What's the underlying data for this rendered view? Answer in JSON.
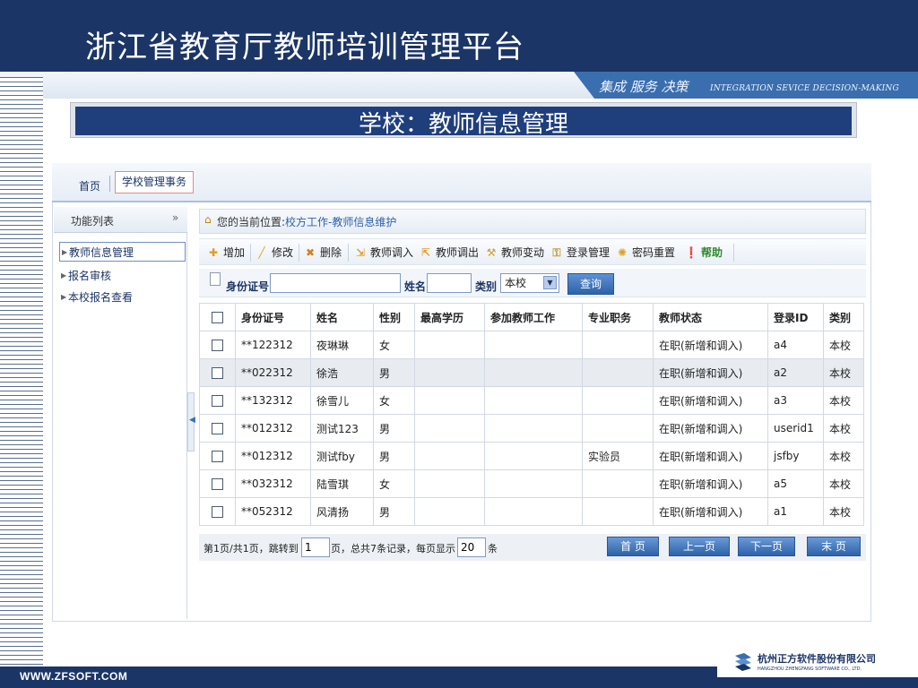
{
  "header": {
    "title": "浙江省教育厅教师培训管理平台",
    "slogan_cn": "集成 服务 决策",
    "slogan_en": "INTEGRATION SEVICE DECISION-MAKING"
  },
  "banner": {
    "title": "学校：教师信息管理"
  },
  "nav": {
    "home": "首页",
    "tab_active": "学校管理事务"
  },
  "sidebar": {
    "header": "功能列表",
    "collapse_icon": "chevron-double-down-icon",
    "items": [
      {
        "label": "教师信息管理",
        "active": true
      },
      {
        "label": "报名审核",
        "active": false
      },
      {
        "label": "本校报名查看",
        "active": false
      }
    ]
  },
  "breadcrumb": {
    "prefix": "您的当前位置:",
    "path": "校方工作-教师信息维护"
  },
  "toolbar": {
    "buttons": [
      {
        "label": "增加",
        "icon": "plus-icon",
        "color": "#e69a1c"
      },
      {
        "label": "修改",
        "icon": "pencil-icon",
        "color": "#d8a62a"
      },
      {
        "label": "删除",
        "icon": "delete-icon",
        "color": "#d97e1e"
      },
      {
        "label": "教师调入",
        "icon": "transfer-in-icon",
        "color": "#e49b2c"
      },
      {
        "label": "教师调出",
        "icon": "transfer-out-icon",
        "color": "#e49b2c"
      },
      {
        "label": "教师变动",
        "icon": "wrench-icon",
        "color": "#d69b2a"
      },
      {
        "label": "登录管理",
        "icon": "user-key-icon",
        "color": "#c99a3a"
      },
      {
        "label": "密码重置",
        "icon": "gear-icon",
        "color": "#e0a01e"
      },
      {
        "label": "帮助",
        "icon": "help-icon",
        "color": "#ea8a10"
      }
    ]
  },
  "search": {
    "id_label": "身份证号",
    "id_value": "",
    "name_label": "姓名",
    "name_value": "",
    "type_label": "类别",
    "type_value": "本校",
    "query_button": "查询"
  },
  "table": {
    "columns": [
      "身份证号",
      "姓名",
      "性别",
      "最高学历",
      "参加教师工作",
      "专业职务",
      "教师状态",
      "登录ID",
      "类别"
    ],
    "rows": [
      [
        "**122312",
        "夜琳琳",
        "女",
        "",
        "",
        "",
        "在职(新增和调入)",
        "a4",
        "本校"
      ],
      [
        "**022312",
        "徐浩",
        "男",
        "",
        "",
        "",
        "在职(新增和调入)",
        "a2",
        "本校"
      ],
      [
        "**132312",
        "徐雪儿",
        "女",
        "",
        "",
        "",
        "在职(新增和调入)",
        "a3",
        "本校"
      ],
      [
        "**012312",
        "测试123",
        "男",
        "",
        "",
        "",
        "在职(新增和调入)",
        "userid1",
        "本校"
      ],
      [
        "**012312",
        "测试fby",
        "男",
        "",
        "",
        "实验员",
        "在职(新增和调入)",
        "jsfby",
        "本校"
      ],
      [
        "**032312",
        "陆雪琪",
        "女",
        "",
        "",
        "",
        "在职(新增和调入)",
        "a5",
        "本校"
      ],
      [
        "**052312",
        "风清扬",
        "男",
        "",
        "",
        "",
        "在职(新增和调入)",
        "a1",
        "本校"
      ]
    ]
  },
  "pager": {
    "prefix": "第1页/共1页，跳转到",
    "page_value": "1",
    "middle": "页，总共7条记录，每页显示",
    "per_page_value": "20",
    "suffix": "条",
    "first": "首 页",
    "prev": "上一页",
    "next": "下一页",
    "last": "末 页"
  },
  "footer": {
    "url": "WWW.ZFSOFT.COM",
    "company_cn": "杭州正方软件股份有限公司",
    "company_en": "HANGZHOU ZHENGFANG SOFTWARE CO., LTD."
  }
}
